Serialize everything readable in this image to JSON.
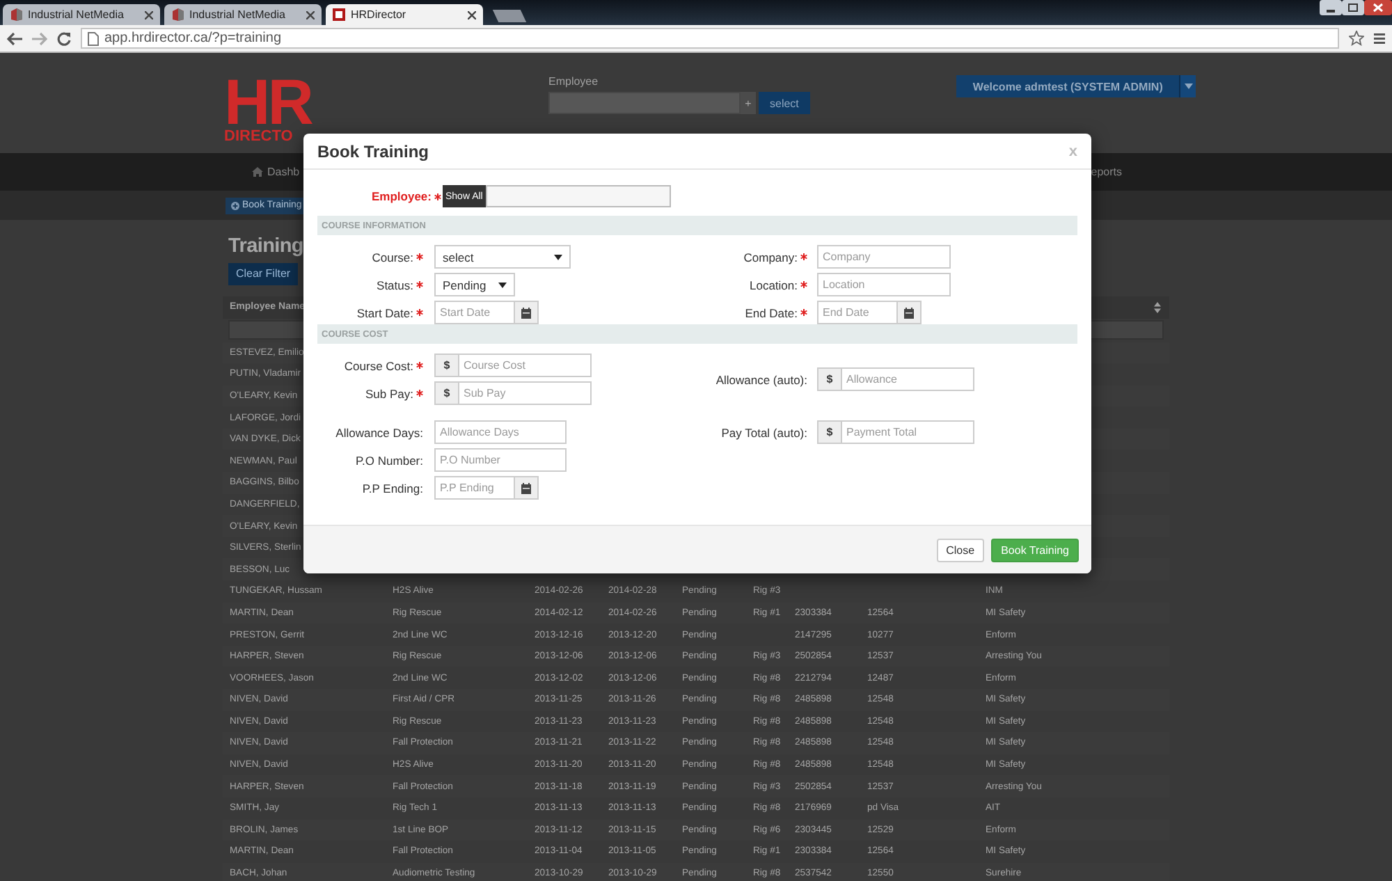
{
  "browser": {
    "tabs": [
      {
        "title": "Industrial NetMedia",
        "selected": false
      },
      {
        "title": "Industrial NetMedia",
        "selected": false
      },
      {
        "title": "HRDirector",
        "selected": true
      }
    ],
    "url": "app.hrdirector.ca/?p=training"
  },
  "header": {
    "logo_mark": "HR",
    "logo_word": "DIRECTO",
    "employee_label": "Employee",
    "employee_add": "+",
    "select_button": "select",
    "welcome": "Welcome admtest (SYSTEM ADMIN)"
  },
  "nav": {
    "left": "Dashb",
    "right": "eports"
  },
  "subbar": {
    "book_button": "Book Training"
  },
  "page": {
    "title": "Training",
    "clear_filter": "Clear Filter",
    "table": {
      "columns": [
        {
          "label": "Employee Name"
        }
      ],
      "rows": [
        {
          "employee_name": "ESTEVEZ, Emilio"
        },
        {
          "employee_name": "PUTIN, Vladamir"
        },
        {
          "employee_name": "O'LEARY, Kevin"
        },
        {
          "employee_name": "LAFORGE, Jordi"
        },
        {
          "employee_name": "VAN DYKE, Dick"
        },
        {
          "employee_name": "NEWMAN, Paul"
        },
        {
          "employee_name": "BAGGINS, Bilbo"
        },
        {
          "employee_name": "DANGERFIELD,"
        },
        {
          "employee_name": "O'LEARY, Kevin"
        },
        {
          "employee_name": "SILVERS, Sterlin"
        },
        {
          "employee_name": "BESSON, Luc"
        },
        {
          "employee_name": "TUNGEKAR, Hussam",
          "column_2": "H2S Alive",
          "column_3": "2014-02-26",
          "column_4": "2014-02-28",
          "column_5": "Pending",
          "column_6": "Rig #3",
          "column_9": "INM"
        },
        {
          "employee_name": "MARTIN, Dean",
          "column_2": "Rig Rescue",
          "column_3": "2014-02-12",
          "column_4": "2014-02-26",
          "column_5": "Pending",
          "column_6": "Rig #1",
          "column_7": "2303384",
          "column_8": "12564",
          "column_9": "MI Safety"
        },
        {
          "employee_name": "PRESTON, Gerrit",
          "column_2": "2nd Line WC",
          "column_3": "2013-12-16",
          "column_4": "2013-12-20",
          "column_5": "Pending",
          "column_7": "2147295",
          "column_8": "10277",
          "column_9": "Enform"
        },
        {
          "employee_name": "HARPER, Steven",
          "column_2": "Rig Rescue",
          "column_3": "2013-12-06",
          "column_4": "2013-12-06",
          "column_5": "Pending",
          "column_6": "Rig #3",
          "column_7": "2502854",
          "column_8": "12537",
          "column_9": "Arresting You"
        },
        {
          "employee_name": "VOORHEES, Jason",
          "column_2": "2nd Line WC",
          "column_3": "2013-12-02",
          "column_4": "2013-12-06",
          "column_5": "Pending",
          "column_6": "Rig #8",
          "column_7": "2212794",
          "column_8": "12487",
          "column_9": "Enform"
        },
        {
          "employee_name": "NIVEN, David",
          "column_2": "First Aid / CPR",
          "column_3": "2013-11-25",
          "column_4": "2013-11-26",
          "column_5": "Pending",
          "column_6": "Rig #8",
          "column_7": "2485898",
          "column_8": "12548",
          "column_9": "MI Safety"
        },
        {
          "employee_name": "NIVEN, David",
          "column_2": "Rig Rescue",
          "column_3": "2013-11-23",
          "column_4": "2013-11-23",
          "column_5": "Pending",
          "column_6": "Rig #8",
          "column_7": "2485898",
          "column_8": "12548",
          "column_9": "MI Safety"
        },
        {
          "employee_name": "NIVEN, David",
          "column_2": "Fall Protection",
          "column_3": "2013-11-21",
          "column_4": "2013-11-22",
          "column_5": "Pending",
          "column_6": "Rig #8",
          "column_7": "2485898",
          "column_8": "12548",
          "column_9": "MI Safety"
        },
        {
          "employee_name": "NIVEN, David",
          "column_2": "H2S Alive",
          "column_3": "2013-11-20",
          "column_4": "2013-11-20",
          "column_5": "Pending",
          "column_6": "Rig #8",
          "column_7": "2485898",
          "column_8": "12548",
          "column_9": "MI Safety"
        },
        {
          "employee_name": "HARPER, Steven",
          "column_2": "Fall Protection",
          "column_3": "2013-11-18",
          "column_4": "2013-11-19",
          "column_5": "Pending",
          "column_6": "Rig #3",
          "column_7": "2502854",
          "column_8": "12537",
          "column_9": "Arresting You"
        },
        {
          "employee_name": "SMITH, Jay",
          "column_2": "Rig Tech 1",
          "column_3": "2013-11-13",
          "column_4": "2013-11-13",
          "column_5": "Pending",
          "column_6": "Rig #8",
          "column_7": "2176969",
          "column_8": "pd Visa",
          "column_9": "AIT"
        },
        {
          "employee_name": "BROLIN, James",
          "column_2": "1st Line BOP",
          "column_3": "2013-11-12",
          "column_4": "2013-11-15",
          "column_5": "Pending",
          "column_6": "Rig #6",
          "column_7": "2303445",
          "column_8": "12529",
          "column_9": "Enform"
        },
        {
          "employee_name": "MARTIN, Dean",
          "column_2": "Fall Protection",
          "column_3": "2013-11-04",
          "column_4": "2013-11-05",
          "column_5": "Pending",
          "column_6": "Rig #1",
          "column_7": "2303384",
          "column_8": "12564",
          "column_9": "MI Safety"
        },
        {
          "employee_name": "BACH, Johan",
          "column_2": "Audiometric Testing",
          "column_3": "2013-10-29",
          "column_4": "2013-10-29",
          "column_5": "Pending",
          "column_6": "Rig #8",
          "column_7": "2537542",
          "column_8": "12550",
          "column_9": "Surehire"
        }
      ]
    }
  },
  "modal": {
    "title": "Book Training",
    "close": "x",
    "employee": {
      "label": "Employee:",
      "required": true,
      "show_all": "Show All"
    },
    "sections": [
      {
        "title": "COURSE INFORMATION",
        "groups": [
          {
            "left": [
              {
                "label": "Course:",
                "required": true,
                "kind": "select",
                "value": "select"
              },
              {
                "label": "Status:",
                "required": true,
                "kind": "select",
                "value": "Pending"
              },
              {
                "label": "Start Date:",
                "required": true,
                "kind": "date",
                "placeholder": "Start Date"
              }
            ],
            "right": [
              {
                "label": "Company:",
                "required": true,
                "kind": "text",
                "placeholder": "Company"
              },
              {
                "label": "Location:",
                "required": true,
                "kind": "text",
                "placeholder": "Location"
              },
              {
                "label": "End Date:",
                "required": true,
                "kind": "date",
                "placeholder": "End Date"
              }
            ]
          }
        ]
      },
      {
        "title": "COURSE COST",
        "groups": [
          {
            "left": [
              {
                "label": "Course Cost:",
                "required": true,
                "kind": "money",
                "addon": "$",
                "placeholder": "Course Cost"
              },
              {
                "label": "Sub Pay:",
                "required": true,
                "kind": "money",
                "addon": "$",
                "placeholder": "Sub Pay"
              }
            ],
            "right": [
              {
                "label": "Allowance (auto):",
                "required": false,
                "kind": "money",
                "addon": "$",
                "placeholder": "Allowance"
              }
            ]
          },
          {
            "left": [
              {
                "label": "Allowance Days:",
                "required": false,
                "kind": "text",
                "placeholder": "Allowance Days"
              },
              {
                "label": "P.O Number:",
                "required": false,
                "kind": "text",
                "placeholder": "P.O Number"
              },
              {
                "label": "P.P Ending:",
                "required": false,
                "kind": "date",
                "placeholder": "P.P Ending"
              }
            ],
            "right": [
              {
                "label": "Pay Total (auto):",
                "required": false,
                "kind": "money",
                "addon": "$",
                "placeholder": "Payment Total"
              }
            ]
          }
        ]
      }
    ],
    "buttons": [
      {
        "label": "Close",
        "kind": "default"
      },
      {
        "label": "Book Training",
        "kind": "primary"
      }
    ]
  }
}
